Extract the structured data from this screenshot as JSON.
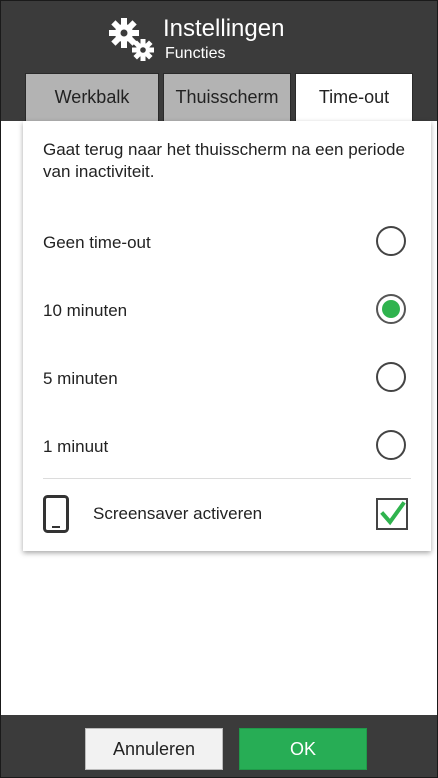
{
  "header": {
    "title": "Instellingen",
    "subtitle": "Functies",
    "icon": "gears-icon"
  },
  "tabs": [
    {
      "label": "Werkbalk",
      "active": false
    },
    {
      "label": "Thuisscherm",
      "active": false
    },
    {
      "label": "Time-out",
      "active": true
    }
  ],
  "panel": {
    "description": "Gaat terug naar het thuisscherm na een periode van inactiviteit.",
    "options": [
      {
        "label": "Geen time-out",
        "selected": false
      },
      {
        "label": "10 minuten",
        "selected": true
      },
      {
        "label": "5 minuten",
        "selected": false
      },
      {
        "label": "1 minuut",
        "selected": false
      }
    ],
    "screensaver": {
      "label": "Screensaver activeren",
      "checked": true,
      "icon": "tablet-icon"
    }
  },
  "footer": {
    "cancel_label": "Annuleren",
    "ok_label": "OK"
  },
  "colors": {
    "header_bg": "#3b3b3b",
    "accent_green": "#2fb34e",
    "ok_button": "#27ad55",
    "inactive_tab": "#b3b3b3"
  }
}
